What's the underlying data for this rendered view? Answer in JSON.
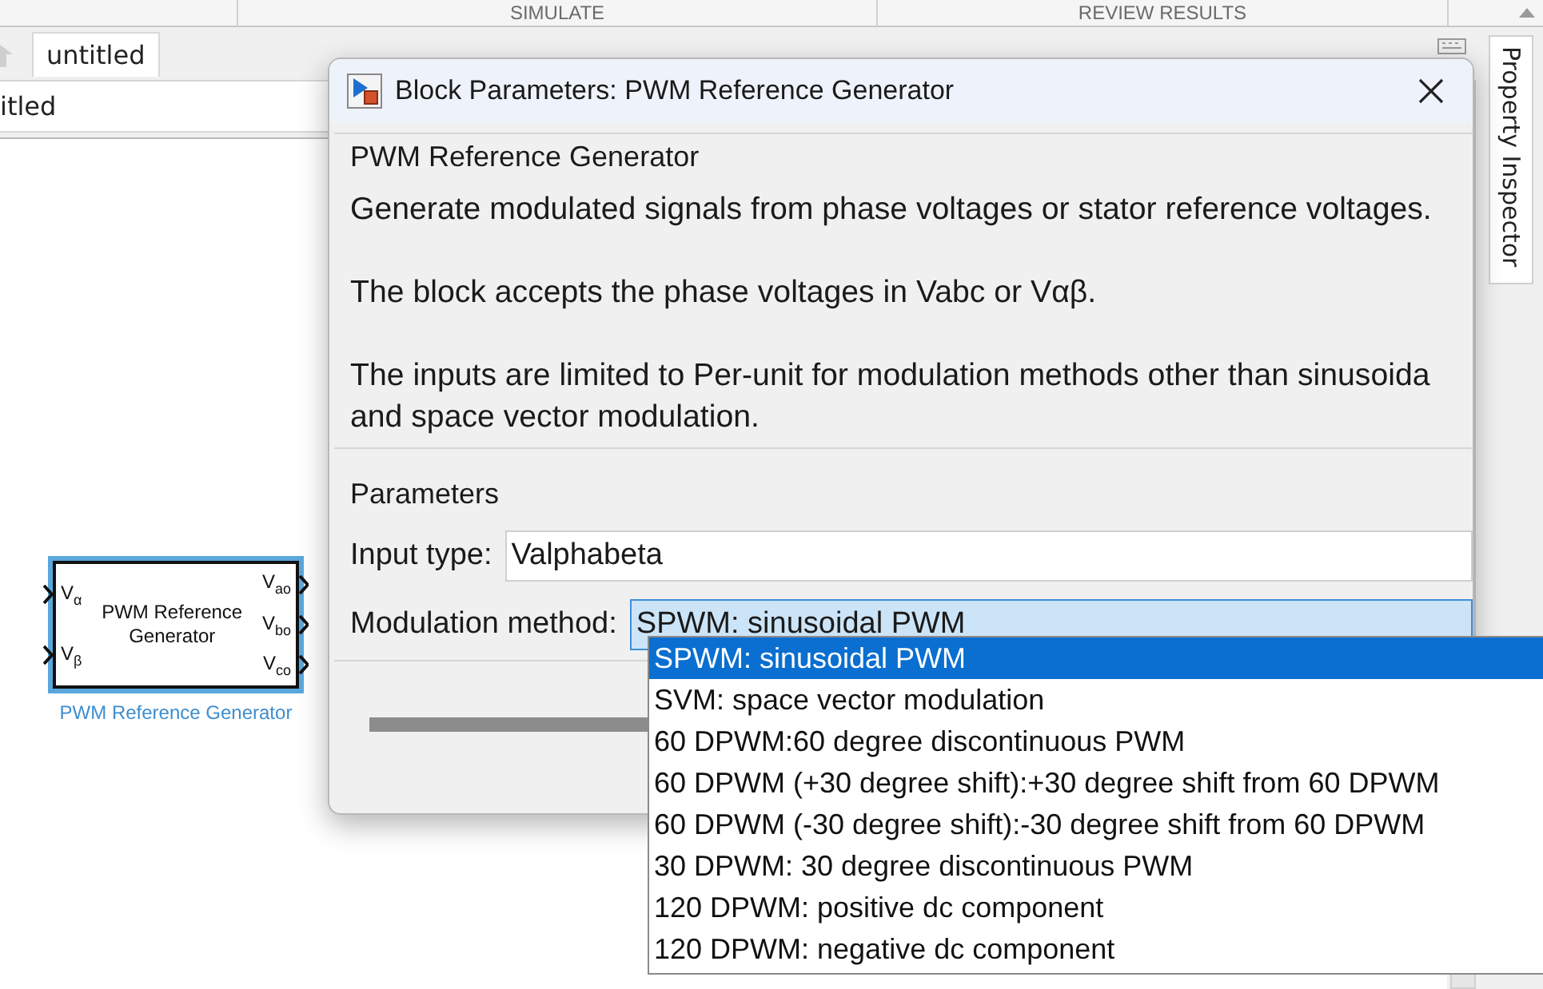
{
  "toolstrip": {
    "sections": [
      "SIMULATE",
      "REVIEW RESULTS"
    ]
  },
  "tabs": [
    {
      "label": "untitled",
      "selected": true
    }
  ],
  "address": "itled",
  "side_tab": "Property Inspector",
  "block": {
    "title": "PWM Reference Generator",
    "name": "PWM Reference Generator",
    "selected": true,
    "inputs": [
      "V$_{α}$",
      "V$_{β}$"
    ],
    "outputs": [
      "V$_{ao}$",
      "V$_{bo}$",
      "V$_{co}$"
    ]
  },
  "dialog": {
    "title": "Block Parameters: PWM Reference Generator",
    "group": "PWM Reference Generator",
    "description": [
      [
        "Generate modulated signals from phase voltages or stator reference voltages."
      ],
      [
        "The block accepts the phase voltages in Vabc or Vαβ."
      ],
      [
        "The inputs are limited to Per-unit for modulation methods other than sinusoida",
        "and space vector modulation."
      ]
    ],
    "parameters_title": "Parameters",
    "fields": [
      {
        "kind": "text",
        "label": "Input type:",
        "value": "Valphabeta"
      },
      {
        "kind": "dropdown",
        "label": "Modulation method:",
        "value": "SPWM: sinusoidal PWM",
        "expanded": true,
        "options": [
          {
            "label": "SPWM: sinusoidal PWM",
            "selected": true
          },
          {
            "label": "SVM: space vector modulation",
            "selected": false
          },
          {
            "label": "60 DPWM:60 degree discontinuous PWM",
            "selected": false
          },
          {
            "label": "60 DPWM (+30 degree shift):+30 degree shift from 60 DPWM",
            "selected": false
          },
          {
            "label": "60 DPWM (-30 degree shift):-30 degree shift from 60 DPWM",
            "selected": false
          },
          {
            "label": "30 DPWM: 30 degree discontinuous PWM",
            "selected": false
          },
          {
            "label": "120 DPWM: positive dc component",
            "selected": false
          },
          {
            "label": "120 DPWM: negative dc component",
            "selected": false
          }
        ]
      }
    ]
  }
}
